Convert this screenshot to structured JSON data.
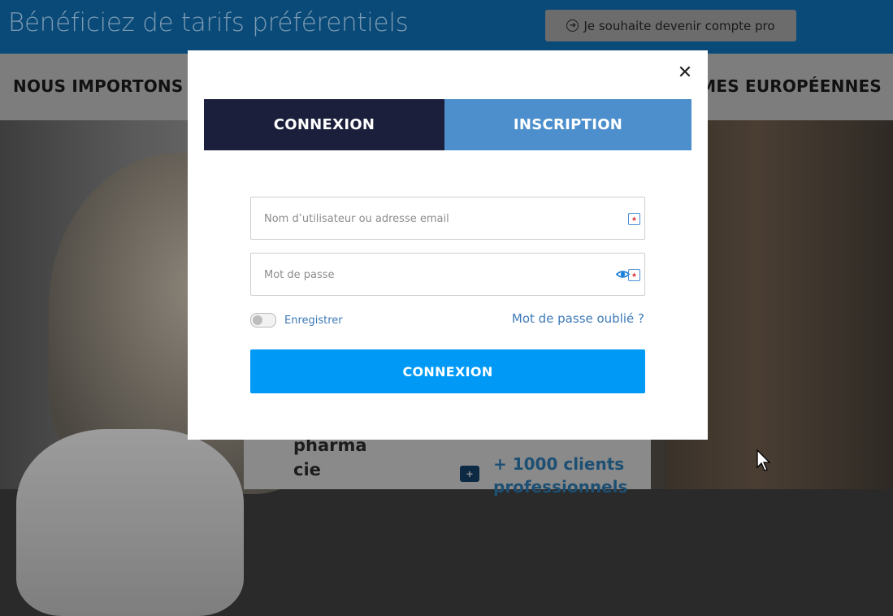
{
  "topbar": {
    "title": "Bénéficiez de tarifs préférentiels",
    "pro_button_label": "Je souhaite devenir compte pro"
  },
  "navbar": {
    "left_text": "NOUS IMPORTONS D",
    "right_text": "RMES EUROPÉENNES"
  },
  "background_card": {
    "word_line1": "pharma",
    "word_line2": "cie",
    "clients_line1": "+ 1000 clients",
    "clients_line2": "professionnels"
  },
  "modal": {
    "tabs": [
      {
        "label": "CONNEXION",
        "active": true
      },
      {
        "label": "INSCRIPTION",
        "active": false
      }
    ],
    "username": {
      "value": "",
      "placeholder": "Nom d’utilisateur ou adresse email"
    },
    "password": {
      "value": "",
      "placeholder": "Mot de passe"
    },
    "remember_label": "Enregistrer",
    "remember_on": false,
    "forgot_label": "Mot de passe oublié ?",
    "submit_label": "CONNEXION"
  },
  "colors": {
    "tab_active": "#1b1f3b",
    "tab_inactive": "#4d8fcc",
    "submit": "#0099f5",
    "link": "#3d7ab8"
  },
  "icons": [
    "arrow-circle-right-icon",
    "close-icon",
    "eye-icon",
    "password-manager-icon",
    "medical-bag-icon",
    "mouse-cursor-icon"
  ]
}
